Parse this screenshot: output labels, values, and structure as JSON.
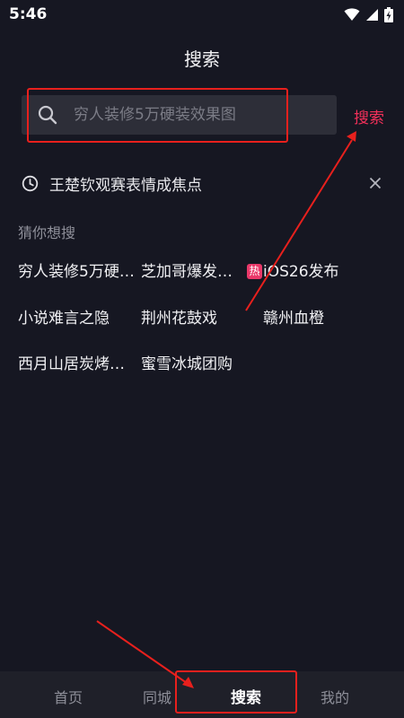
{
  "status_bar": {
    "time": "5:46"
  },
  "header": {
    "title": "搜索"
  },
  "search": {
    "placeholder": "穷人装修5万硬装效果图",
    "action_label": "搜索"
  },
  "history": {
    "item": "王楚钦观赛表情成焦点"
  },
  "suggestions": {
    "title": "猜你想搜",
    "items": [
      {
        "label": "穷人装修5万硬…"
      },
      {
        "label": "芝加哥爆发…"
      },
      {
        "label": "iOS26发布",
        "badge": "热"
      },
      {
        "label": "小说难言之隐"
      },
      {
        "label": "荆州花鼓戏"
      },
      {
        "label": "赣州血橙"
      },
      {
        "label": "西月山居炭烤…"
      },
      {
        "label": "蜜雪冰城团购"
      }
    ]
  },
  "bottom_nav": {
    "items": [
      {
        "label": "首页"
      },
      {
        "label": "同城"
      },
      {
        "label": "搜索"
      },
      {
        "label": "我的"
      }
    ]
  },
  "colors": {
    "accent": "#f3305a",
    "annotation": "#e8201d",
    "background": "#161722"
  }
}
